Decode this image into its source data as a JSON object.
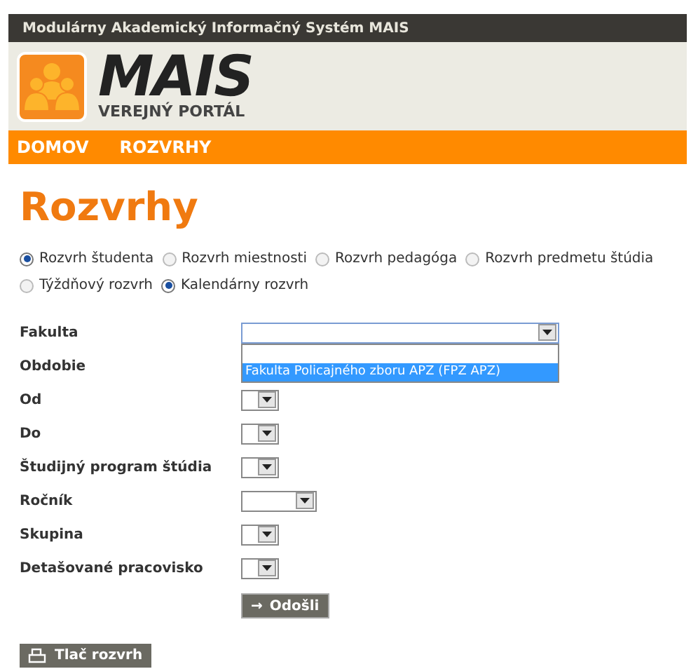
{
  "top_bar": {
    "title": "Modulárny Akademický Informačný Systém MAIS"
  },
  "logo": {
    "name": "MAIS",
    "subtitle": "VEREJNÝ PORTÁL"
  },
  "nav": [
    {
      "label": "DOMOV"
    },
    {
      "label": "ROZVRHY"
    }
  ],
  "heading": "Rozvrhy",
  "radio_groups": [
    [
      {
        "label": "Rozvrh študenta",
        "selected": true
      },
      {
        "label": "Rozvrh miestnosti",
        "selected": false
      },
      {
        "label": "Rozvrh pedagóga",
        "selected": false
      },
      {
        "label": "Rozvrh predmetu štúdia",
        "selected": false
      }
    ],
    [
      {
        "label": "Týždňový rozvrh",
        "selected": false
      },
      {
        "label": "Kalendárny rozvrh",
        "selected": true
      }
    ]
  ],
  "fields": [
    {
      "label": "Fakulta",
      "kind": "wide",
      "expanded": true,
      "options": [
        {
          "label": "Fakulta Policajného zboru APZ (FPZ APZ)",
          "selected": true
        }
      ]
    },
    {
      "label": "Obdobie",
      "kind": "hidden"
    },
    {
      "label": "Od",
      "kind": "narrow"
    },
    {
      "label": "Do",
      "kind": "narrow"
    },
    {
      "label": "Študijný program štúdia",
      "kind": "narrow"
    },
    {
      "label": "Ročník",
      "kind": "medium"
    },
    {
      "label": "Skupina",
      "kind": "narrow"
    },
    {
      "label": "Detašované pracovisko",
      "kind": "narrow"
    }
  ],
  "submit_button": {
    "icon": "→",
    "label": "Odošli"
  },
  "print_button": {
    "label": "Tlač rozvrh"
  }
}
